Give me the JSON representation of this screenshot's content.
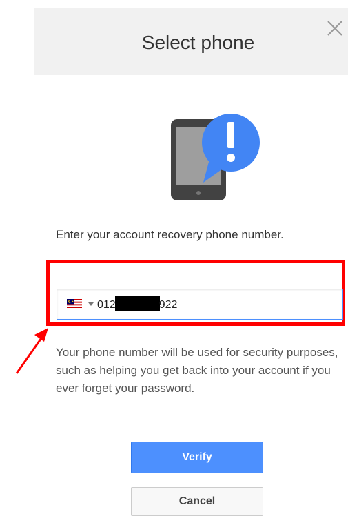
{
  "dialog": {
    "title": "Select phone",
    "close_icon": "close-icon",
    "illustration_icon": "phone-alert-icon",
    "instruction": "Enter your account recovery phone number.",
    "phone_field": {
      "country_flag_icon": "malaysia-flag-icon",
      "value_prefix": "012",
      "value_suffix": "922"
    },
    "helper_text": "Your phone number will be used for security purposes, such as helping you get back into your account if you ever forget your password.",
    "verify_label": "Verify",
    "cancel_label": "Cancel"
  },
  "colors": {
    "header_bg": "#f1f1f1",
    "primary_button": "#4d90fe",
    "alert_circle": "#4285f4",
    "annotation_red": "#ff0000"
  }
}
